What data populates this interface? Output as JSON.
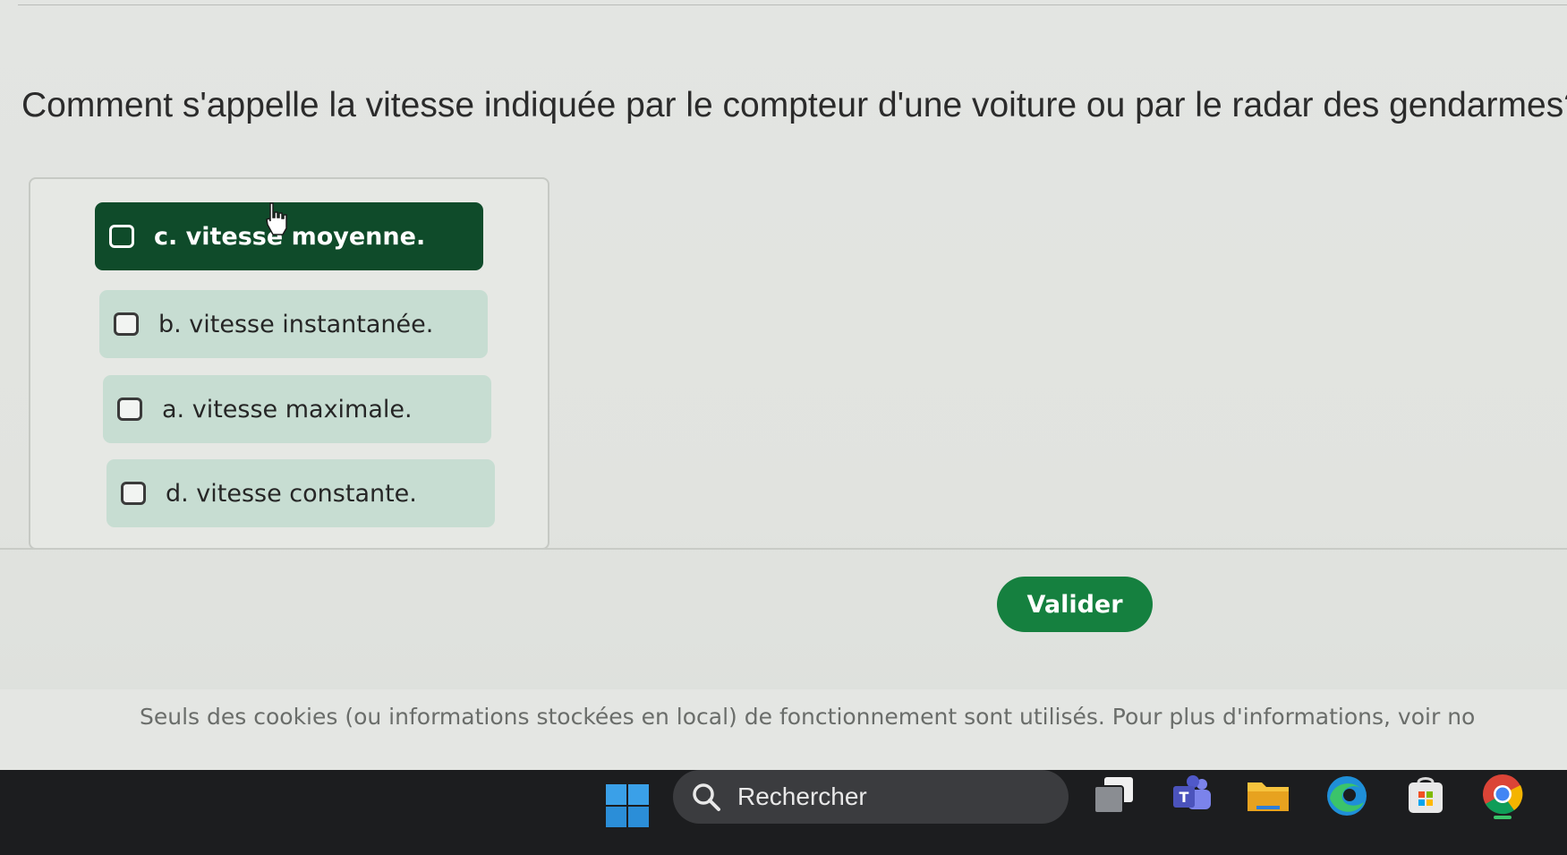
{
  "question": {
    "text": "Comment s'appelle la vitesse indiquée par le compteur d'une voiture ou par le radar des gendarmes?"
  },
  "options": [
    {
      "label": "c. vitesse moyenne.",
      "selected": true
    },
    {
      "label": "b. vitesse instantanée.",
      "selected": false
    },
    {
      "label": "a. vitesse maximale.",
      "selected": false
    },
    {
      "label": "d. vitesse constante.",
      "selected": false
    }
  ],
  "actions": {
    "submit_label": "Valider"
  },
  "cookie_notice": {
    "text": "Seuls des cookies (ou informations stockées en local) de fonctionnement sont utilisés. Pour plus d'informations, voir no"
  },
  "taskbar": {
    "search_placeholder": "Rechercher",
    "icons": [
      "windows-start-icon",
      "task-view-icon",
      "teams-icon",
      "file-explorer-icon",
      "edge-icon",
      "store-icon",
      "chrome-icon"
    ]
  },
  "colors": {
    "selected_option": "#0f4b2a",
    "option": "#c7ddd2",
    "submit": "#15803f",
    "taskbar": "#1c1d1f"
  }
}
